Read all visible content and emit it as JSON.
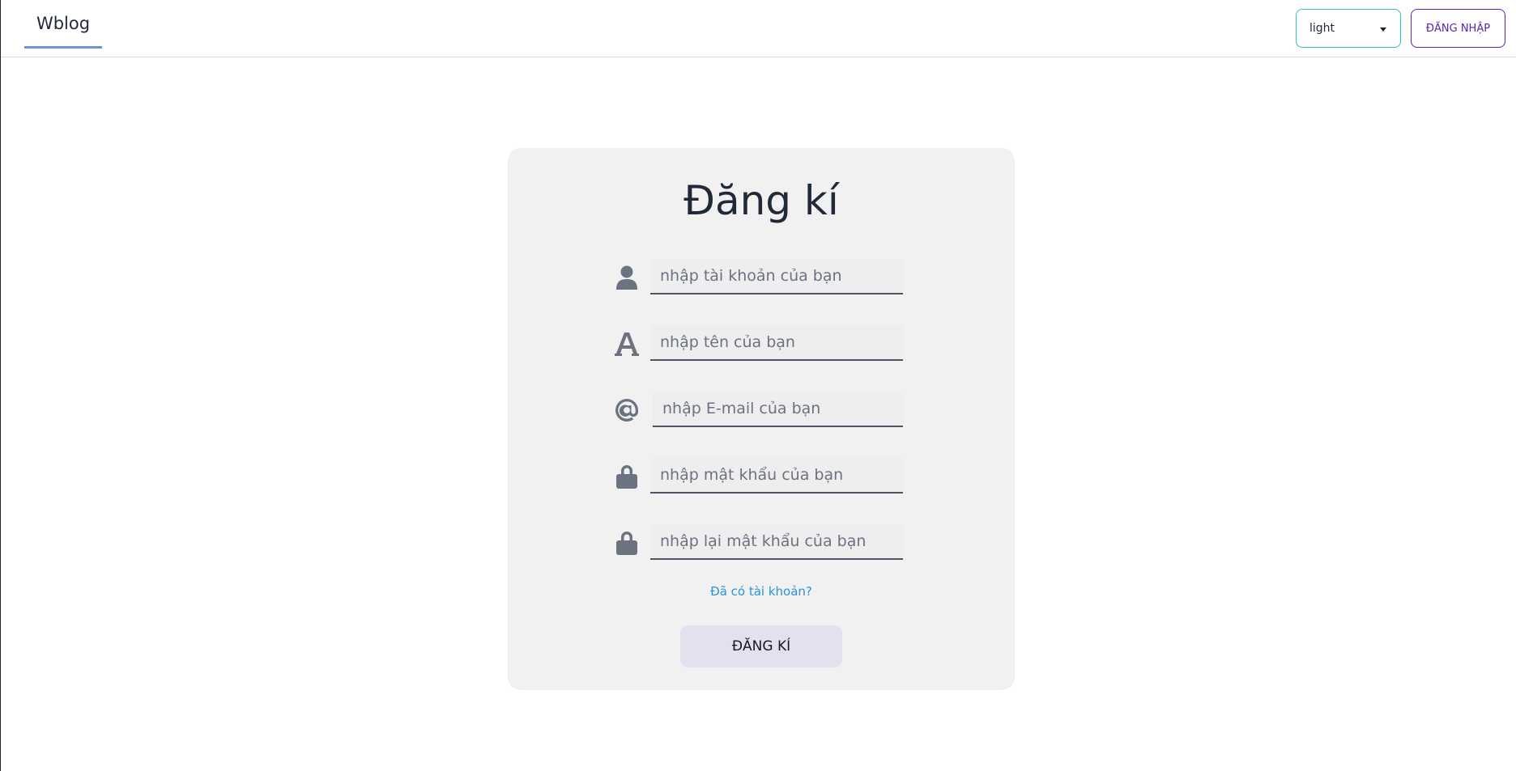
{
  "navbar": {
    "brand": "Wblog",
    "theme_select_value": "light",
    "login_label": "ĐĂNG NHẬP"
  },
  "form": {
    "title": "Đăng kí",
    "fields": [
      {
        "icon": "user-icon",
        "placeholder": "nhập tài khoản của bạn"
      },
      {
        "icon": "font-icon",
        "placeholder": "nhập tên của bạn"
      },
      {
        "icon": "at-icon",
        "placeholder": "nhập E-mail của bạn"
      },
      {
        "icon": "lock-icon",
        "placeholder": "nhập mật khẩu của bạn"
      },
      {
        "icon": "lock-icon",
        "placeholder": "nhập lại mật khẩu của bạn"
      }
    ],
    "have_account_link": "Đã có tài khoản?",
    "submit_label": "ĐĂNG KÍ"
  },
  "colors": {
    "icon": "#6b7280",
    "accent_link": "#2b93d6",
    "login_border": "#5b21b6",
    "select_border": "#2ec4b6"
  }
}
